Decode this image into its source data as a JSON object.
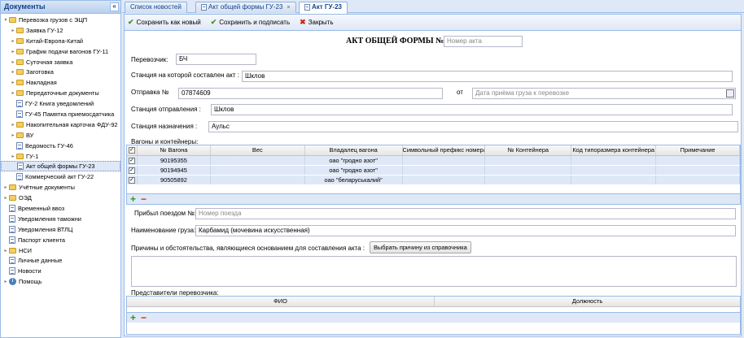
{
  "sidebar": {
    "title": "Документы",
    "collapse": "«",
    "items": [
      {
        "label": "Перевозка грузов с ЭЦП",
        "icon": "folder",
        "level": 0,
        "expanded": true
      },
      {
        "label": "Заявка ГУ-12",
        "icon": "folder",
        "level": 1
      },
      {
        "label": "Китай-Европа-Китай",
        "icon": "folder",
        "level": 1
      },
      {
        "label": "График подачи вагонов ГУ-11",
        "icon": "folder",
        "level": 1
      },
      {
        "label": "Суточная заявка",
        "icon": "folder",
        "level": 1
      },
      {
        "label": "Заготовка",
        "icon": "folder",
        "level": 1
      },
      {
        "label": "Накладная",
        "icon": "folder",
        "level": 1
      },
      {
        "label": "Передаточные документы",
        "icon": "folder",
        "level": 1
      },
      {
        "label": "ГУ-2 Книга уведомлений",
        "icon": "doc",
        "level": 1
      },
      {
        "label": "ГУ-45 Памятка приемосдатчика",
        "icon": "doc",
        "level": 1
      },
      {
        "label": "Накопительная карточка ФДУ-92",
        "icon": "folder",
        "level": 1
      },
      {
        "label": "ВУ",
        "icon": "folder",
        "level": 1
      },
      {
        "label": "Ведомость ГУ-46",
        "icon": "doc",
        "level": 1
      },
      {
        "label": "ГУ-1",
        "icon": "folder",
        "level": 1
      },
      {
        "label": "Акт общей формы ГУ-23",
        "icon": "doc",
        "level": 1,
        "selected": true
      },
      {
        "label": "Коммерческий акт ГУ-22",
        "icon": "doc",
        "level": 1
      },
      {
        "label": "Учётные документы",
        "icon": "folder",
        "level": 0
      },
      {
        "label": "ОЭД",
        "icon": "folder",
        "level": 0
      },
      {
        "label": "Временный ввоз",
        "icon": "doc",
        "level": 0
      },
      {
        "label": "Уведомления таможни",
        "icon": "doc",
        "level": 0
      },
      {
        "label": "Уведомления ВТЛЦ",
        "icon": "doc",
        "level": 0
      },
      {
        "label": "Паспорт клиента",
        "icon": "doc",
        "level": 0
      },
      {
        "label": "НСИ",
        "icon": "folder",
        "level": 0
      },
      {
        "label": "Личные данные",
        "icon": "doc",
        "level": 0
      },
      {
        "label": "Новости",
        "icon": "doc",
        "level": 0
      },
      {
        "label": "Помощь",
        "icon": "info",
        "level": 0
      }
    ]
  },
  "tabs": {
    "news": "Список новостей",
    "act_form": "Акт общей формы ГУ-23",
    "act": "Акт ГУ-23",
    "close": "×"
  },
  "toolbar": {
    "save_new": "Сохранить как новый",
    "save_sign": "Сохранить и подписать",
    "close": "Закрыть"
  },
  "form": {
    "title": "АКТ ОБЩЕЙ ФОРМЫ №",
    "act_number_placeholder": "Номер акта",
    "carrier_label": "Перевозчик:",
    "carrier_value": "БЧ",
    "station_compiled_label": "Станция на которой составлен акт :",
    "station_compiled_value": "Шклов",
    "shipment_label": "Отправка №",
    "shipment_value": "07874609",
    "from_label": "от",
    "date_placeholder": "Дата приёма груза к перевозке",
    "departure_label": "Станция отправления :",
    "departure_value": "Шклов",
    "destination_label": "Станция назначения :",
    "destination_value": "Аульс",
    "wagons_label": "Вагоны и контейнеры:",
    "train_label": "Прибыл поездом №:",
    "train_placeholder": "Номер поезда",
    "cargo_label": "Наименование груза:",
    "cargo_value": "Карбамид (мочевина искусственная)",
    "reasons_label": "Причины и обстоятельства, являющиеся основанием для составления акта :",
    "choose_reason": "Выбрать причину из справочника",
    "reps_label": "Представители перевозчика:"
  },
  "wagons": {
    "columns": [
      "№ Вагона",
      "Вес",
      "Владалец вагона",
      "Символьный префикс номера к",
      "№ Контейнера",
      "Код типоразмера контейнера",
      "Примечание"
    ],
    "rows": [
      {
        "number": "90195355",
        "weight": "",
        "owner": "оао \"гродно азот\""
      },
      {
        "number": "90194945",
        "weight": "",
        "owner": "оао \"гродно азот\""
      },
      {
        "number": "90505892",
        "weight": "",
        "owner": "оао \"беларуськалий\""
      }
    ],
    "checkmark": "✓"
  },
  "reps": {
    "columns": [
      "ФИО",
      "Должность"
    ]
  },
  "icons": {
    "plus": "+",
    "minus": "−",
    "check": "✔",
    "x": "✖"
  }
}
